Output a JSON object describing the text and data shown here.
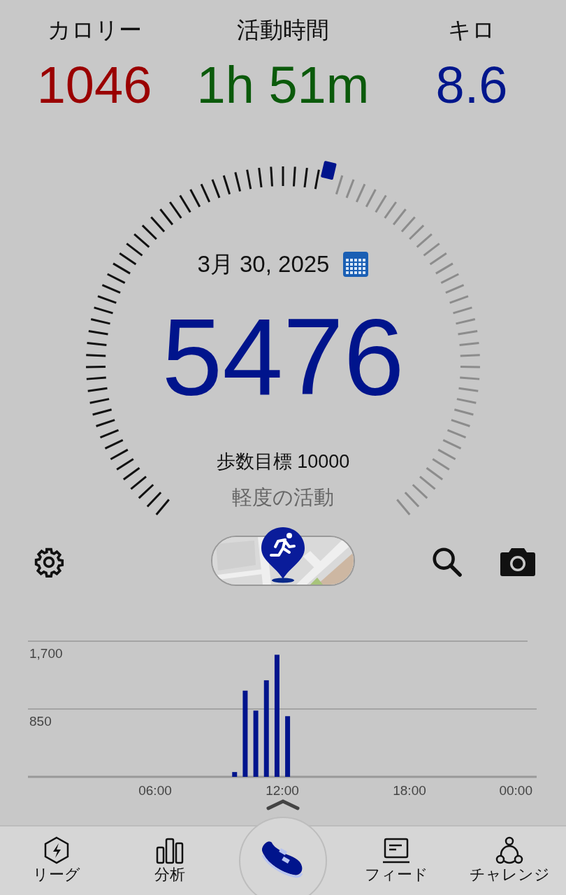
{
  "stats": [
    {
      "label": "カロリー",
      "value": "1046",
      "color": "#9a0000"
    },
    {
      "label": "活動時間",
      "value": "1h 51m",
      "color": "#0b5a0b"
    },
    {
      "label": "キロ",
      "value": "8.6",
      "color": "#00168c"
    }
  ],
  "gauge": {
    "date": "3月 30, 2025",
    "steps": "5476",
    "goal": "歩数目標 10000",
    "activity": "軽度の活動"
  },
  "chart": {
    "chart_data": {
      "type": "bar",
      "x": [
        9.75,
        10.25,
        10.75,
        11.25,
        11.75,
        12.25
      ],
      "series": [
        {
          "color": "#00148c",
          "values": [
            60,
            1080,
            830,
            1210,
            1530,
            760
          ]
        }
      ],
      "xlim": [
        0,
        24
      ],
      "ylim": [
        0,
        1700
      ],
      "xticks": [
        {
          "value": 6,
          "label": "06:00"
        },
        {
          "value": 12,
          "label": "12:00"
        },
        {
          "value": 18,
          "label": "18:00"
        },
        {
          "value": 24,
          "label": "00:00"
        }
      ],
      "yticks": [
        {
          "value": 850,
          "label": "850"
        },
        {
          "value": 1700,
          "label": "1,700"
        }
      ]
    }
  },
  "nav": [
    {
      "kind": "league",
      "label": "リーグ",
      "selected": false
    },
    {
      "kind": "analysis",
      "label": "分析",
      "selected": false
    },
    {
      "kind": "home",
      "selected": true
    },
    {
      "kind": "feed",
      "label": "フィード",
      "selected": false
    },
    {
      "kind": "challenge",
      "label": "チャレンジ",
      "selected": false
    }
  ]
}
